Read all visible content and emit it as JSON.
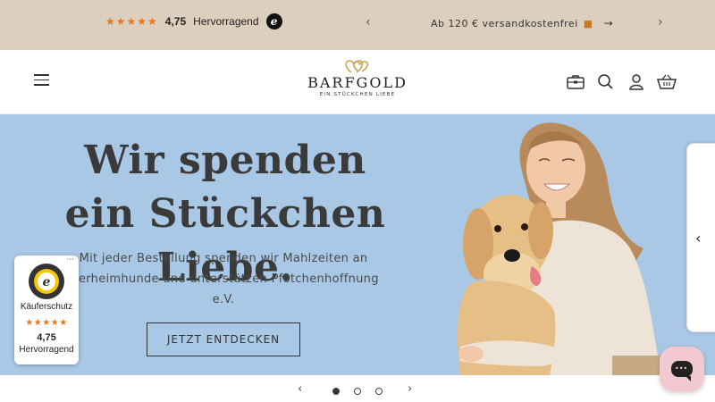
{
  "announcement": {
    "stars": "★★★★★",
    "rating_score": "4,75",
    "rating_label": "Hervorragend",
    "trusted_logo": "e",
    "prev": "‹",
    "next": "›",
    "shipping_text": "Ab 120 € versandkostenfrei",
    "truck_icon": "truck-icon",
    "arrow": "→"
  },
  "header": {
    "logo_name": "BARFGOLD",
    "logo_tagline": "EIN STÜCKCHEN LIEBE",
    "icons": [
      "menu-icon",
      "box-icon",
      "search-icon",
      "account-icon",
      "basket-icon"
    ]
  },
  "hero": {
    "title": "Wir spenden ein Stückchen Liebe.",
    "text": "Mit jeder Bestellung spenden wir Mahlzeiten an Tierheimhunde und unterstützen Pfötchenhoffnung e.V.",
    "button_label": "JETZT ENTDECKEN",
    "background_color": "#a9c8e6"
  },
  "side_tab": {
    "chevron": "‹"
  },
  "trusted_badge": {
    "more": "···",
    "label": "Käuferschutz",
    "stars": "★★★★★",
    "score": "4,75",
    "rating_label": "Hervorragend"
  },
  "carousel": {
    "prev": "‹",
    "next": "›",
    "total_slides": 3,
    "active_slide": 1
  },
  "colors": {
    "accent_star": "#e87722",
    "topbar": "#dccfbd",
    "chat": "#f2c9d1"
  }
}
